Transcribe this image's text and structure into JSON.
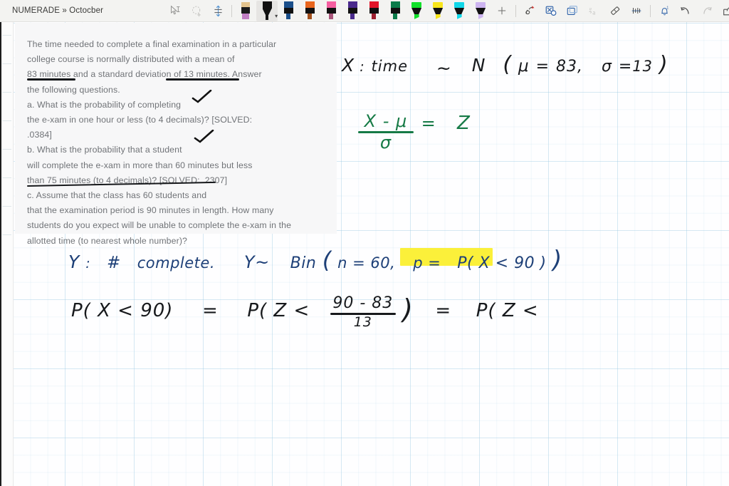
{
  "app": {
    "title": "NUMERADE » Octocber"
  },
  "toolbar": {
    "tools": [
      {
        "name": "select-lasso-icon",
        "label": "Select"
      },
      {
        "name": "lasso-select-icon",
        "label": "Lasso Select"
      },
      {
        "name": "spacing-icon",
        "label": "Insert Space"
      },
      {
        "name": "crayon-tool",
        "label": "Pencil",
        "cap": "#e3c38d",
        "tip": "#c27fc4"
      },
      {
        "name": "pen-black",
        "label": "Pen Black",
        "color": "#111111",
        "selected": true
      },
      {
        "name": "pen-navy",
        "label": "Pen Navy",
        "color": "#1b4f8a"
      },
      {
        "name": "pen-orange",
        "label": "Pen Orange",
        "color": "#e8651d"
      },
      {
        "name": "pen-pink",
        "label": "Pen Pink",
        "color": "#f55ea0"
      },
      {
        "name": "pen-purple",
        "label": "Pen Purple",
        "color": "#4a2a8c"
      },
      {
        "name": "pen-red",
        "label": "Pen Red",
        "color": "#e2162a"
      },
      {
        "name": "pen-green",
        "label": "Pen Dark Green",
        "color": "#0b7b4a"
      },
      {
        "name": "highlighter-green",
        "label": "Highlighter Green",
        "color": "#12e02a"
      },
      {
        "name": "highlighter-yellow",
        "label": "Highlighter Yellow",
        "color": "#f8e51b"
      },
      {
        "name": "highlighter-cyan",
        "label": "Highlighter Cyan",
        "color": "#12d7e8"
      },
      {
        "name": "highlighter-lavender",
        "label": "Highlighter Lavender",
        "color": "#cdb4f0"
      }
    ],
    "actions": [
      {
        "name": "add-pen-button",
        "label": "+"
      },
      {
        "name": "ink-to-shape-icon",
        "label": "Ink to Shape"
      },
      {
        "name": "ink-to-math-icon",
        "label": "Ink to Math"
      },
      {
        "name": "ink-replay-icon",
        "label": "Ink Replay"
      },
      {
        "name": "ink-to-text-icon",
        "label": "Ink to Text"
      },
      {
        "name": "eraser-icon",
        "label": "Eraser"
      },
      {
        "name": "ruler-icon",
        "label": "Ruler"
      },
      {
        "name": "notifications-icon",
        "label": "Notifications",
        "badge": "1"
      },
      {
        "name": "undo-icon",
        "label": "Undo"
      },
      {
        "name": "redo-icon",
        "label": "Redo"
      },
      {
        "name": "share-icon",
        "label": "Share"
      },
      {
        "name": "collapse-ribbon-icon",
        "label": "Collapse Ribbon"
      }
    ]
  },
  "question_card": {
    "lines": [
      "The time needed to complete a final examination in a particular",
      "college course is normally distributed with a mean of",
      "83 minutes and a standard deviation of 13 minutes. Answer",
      "the following questions.",
      "a. What is the probability of completing",
      "the e-xam in one hour or less (to 4 decimals)? [SOLVED:",
      ".0384]",
      "b. What is the probability that a student",
      "will complete the e-xam in more than 60 minutes but less",
      "than 75 minutes (to 4 decimals)? [SOLVED: .2307]",
      "c. Assume that the class has 60 students and",
      "that the examination period is 90 minutes in length. How many",
      "students do you expect will be unable to complete the e-xam in the",
      "allotted time (to nearest whole number)?"
    ]
  },
  "annotations": {
    "line1": {
      "X": "X",
      "colon": ":",
      "time": "time",
      "tilde": "~",
      "N": "N",
      "open": "(",
      "mu": "μ",
      "eq1": "=",
      "mean": "83",
      "comma": ",",
      "sigma": "σ",
      "eq2": "=",
      "sd": "13",
      "close": ")"
    },
    "zscore": {
      "numerator": "X - μ",
      "denominator": "σ",
      "equals": "=",
      "z": "Z"
    },
    "line3": {
      "Y": "Y",
      "colon": ":",
      "hash": "#",
      "complete": "complete",
      "period": ".",
      "Y2": "Y~",
      "bin": "Bin",
      "open": "(",
      "n_eq": "n = 60,",
      "p_eq": "p =",
      "highlighted": "P( X < 90 )",
      "close": ")"
    },
    "line4": {
      "lhs": "P( X < 90)",
      "equals": "=",
      "rhs_open": "P( Z <",
      "frac_num": "90 - 83",
      "frac_den": "13",
      "rhs_close": ")",
      "equals2": "=",
      "tail": "P( Z <"
    },
    "colors": {
      "black_ink": "#17191c",
      "blue_ink": "#1d3f77",
      "green_ink": "#167a46",
      "highlight_yellow": "#fbf03a"
    }
  }
}
